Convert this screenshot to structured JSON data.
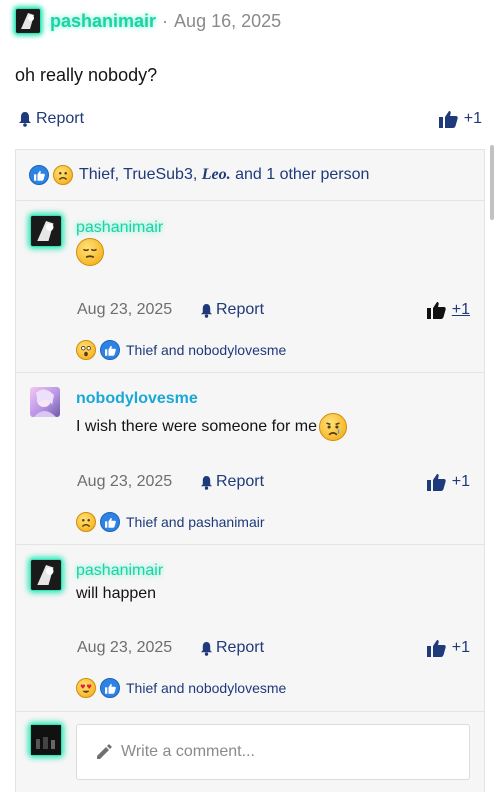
{
  "post": {
    "author": "pashanimair",
    "separator": "·",
    "date": "Aug 16, 2025",
    "body": "oh really nobody?",
    "report_label": "Report",
    "likes": "+1"
  },
  "reactions_summary": {
    "icons": [
      "like-reaction",
      "sad-reaction"
    ],
    "names": "Thief, TrueSub3,",
    "name_styled": "Leo.",
    "suffix": "and 1 other person"
  },
  "comments": [
    {
      "author": "pashanimair",
      "text": "",
      "emoji": "pensive-face",
      "date": "Aug 23, 2025",
      "report_label": "Report",
      "likes": "+1",
      "reactions_icons": [
        "astonished-reaction",
        "like-reaction"
      ],
      "reactions_text": "Thief and nobodylovesme"
    },
    {
      "author": "nobodylovesme",
      "text": "I wish there were someone for me",
      "emoji": "crying-face",
      "date": "Aug 23, 2025",
      "report_label": "Report",
      "likes": "+1",
      "reactions_icons": [
        "sad-reaction",
        "like-reaction"
      ],
      "reactions_text": "Thief and pashanimair"
    },
    {
      "author": "pashanimair",
      "text": "will happen",
      "date": "Aug 23, 2025",
      "report_label": "Report",
      "likes": "+1",
      "reactions_icons": [
        "heart-eyes-reaction",
        "like-reaction"
      ],
      "reactions_text": "Thief and nobodylovesme"
    }
  ],
  "composer": {
    "placeholder": "Write a comment..."
  },
  "colors": {
    "accent_glow": "#1bd3a4",
    "link_blue": "#1f3a7a",
    "username_blue": "#1aa8d6"
  }
}
